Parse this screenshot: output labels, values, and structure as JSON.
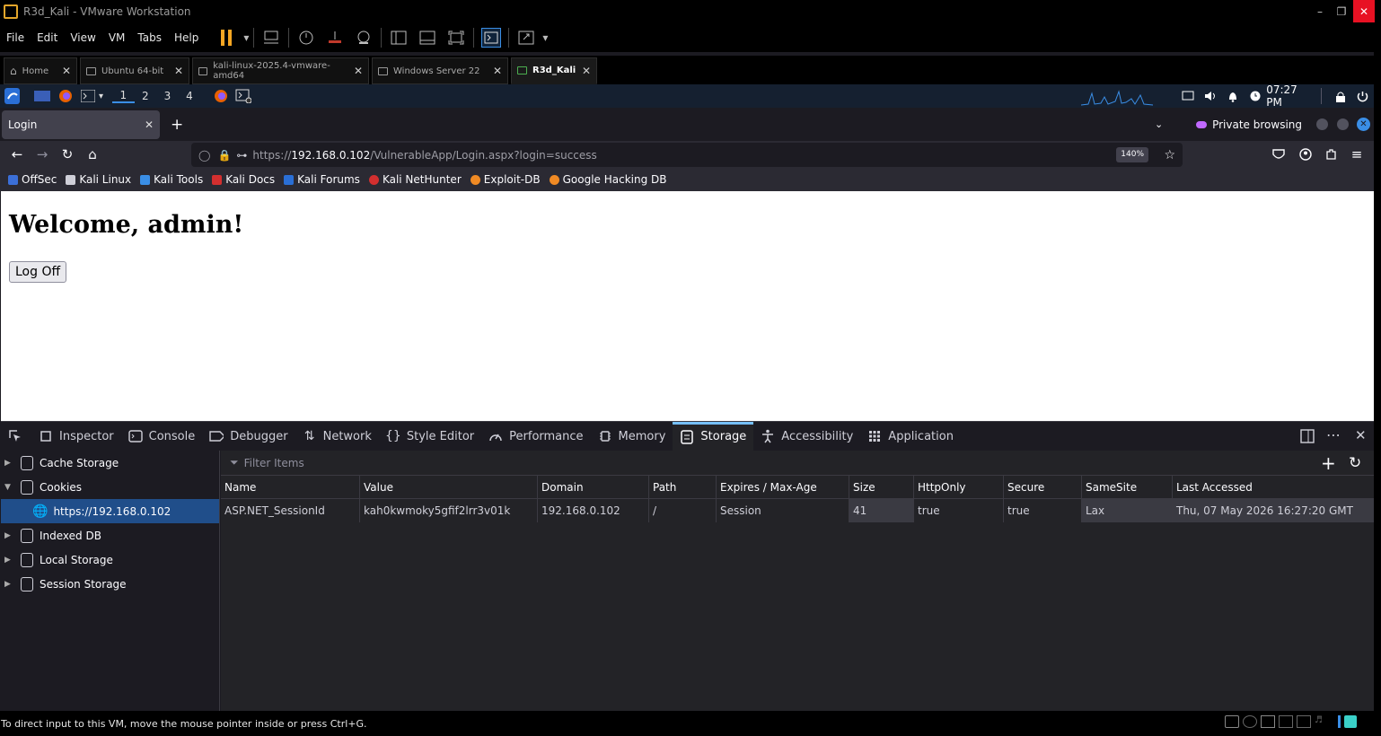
{
  "vmware": {
    "title": "R3d_Kali - VMware Workstation",
    "menu": [
      "File",
      "Edit",
      "View",
      "VM",
      "Tabs",
      "Help"
    ],
    "tabs": [
      {
        "label": "Home",
        "icon": "home-icon"
      },
      {
        "label": "Ubuntu 64-bit",
        "icon": "vm-icon"
      },
      {
        "label": "kali-linux-2025.4-vmware-amd64",
        "icon": "vm-icon"
      },
      {
        "label": "Windows Server 22",
        "icon": "vm-icon"
      },
      {
        "label": "R3d_Kali",
        "icon": "vm-running-icon"
      }
    ],
    "status_text": "To direct input to this VM, move the mouse pointer inside or press Ctrl+G."
  },
  "kali_panel": {
    "workspaces": [
      "1",
      "2",
      "3",
      "4"
    ],
    "clock": "07:27 PM"
  },
  "firefox": {
    "tab_title": "Login",
    "private_label": "Private browsing",
    "url_prefix": "https://",
    "url_host": "192.168.0.102",
    "url_path": "/VulnerableApp/Login.aspx?login=success",
    "zoom": "140%",
    "bookmarks": [
      {
        "label": "OffSec",
        "color": "#3b6fd8"
      },
      {
        "label": "Kali Linux",
        "color": "#cfcfd8"
      },
      {
        "label": "Kali Tools",
        "color": "#3a8ee6"
      },
      {
        "label": "Kali Docs",
        "color": "#d32f2f"
      },
      {
        "label": "Kali Forums",
        "color": "#2a6fd6"
      },
      {
        "label": "Kali NetHunter",
        "color": "#d32f2f"
      },
      {
        "label": "Exploit-DB",
        "color": "#f08a24"
      },
      {
        "label": "Google Hacking DB",
        "color": "#f08a24"
      }
    ]
  },
  "page": {
    "heading": "Welcome, admin!",
    "logoff_label": "Log Off"
  },
  "devtools": {
    "tabs": [
      {
        "label": "Inspector",
        "icon": "inspector-icon"
      },
      {
        "label": "Console",
        "icon": "console-icon"
      },
      {
        "label": "Debugger",
        "icon": "debugger-icon"
      },
      {
        "label": "Network",
        "icon": "network-icon"
      },
      {
        "label": "Style Editor",
        "icon": "style-editor-icon"
      },
      {
        "label": "Performance",
        "icon": "performance-icon"
      },
      {
        "label": "Memory",
        "icon": "memory-icon"
      },
      {
        "label": "Storage",
        "icon": "storage-icon",
        "active": true
      },
      {
        "label": "Accessibility",
        "icon": "accessibility-icon"
      },
      {
        "label": "Application",
        "icon": "application-icon"
      }
    ],
    "sidebar": [
      {
        "label": "Cache Storage",
        "expanded": false
      },
      {
        "label": "Cookies",
        "expanded": true
      },
      {
        "label": "https://192.168.0.102",
        "child": true,
        "selected": true
      },
      {
        "label": "Indexed DB",
        "expanded": false
      },
      {
        "label": "Local Storage",
        "expanded": false
      },
      {
        "label": "Session Storage",
        "expanded": false
      }
    ],
    "filter_placeholder": "Filter Items",
    "columns": [
      "Name",
      "Value",
      "Domain",
      "Path",
      "Expires / Max-Age",
      "Size",
      "HttpOnly",
      "Secure",
      "SameSite",
      "Last Accessed"
    ],
    "rows": [
      [
        "ASP.NET_SessionId",
        "kah0kwmoky5gfif2lrr3v01k",
        "192.168.0.102",
        "/",
        "Session",
        "41",
        "true",
        "true",
        "Lax",
        "Thu, 07 May 2026 16:27:20 GMT"
      ]
    ]
  }
}
